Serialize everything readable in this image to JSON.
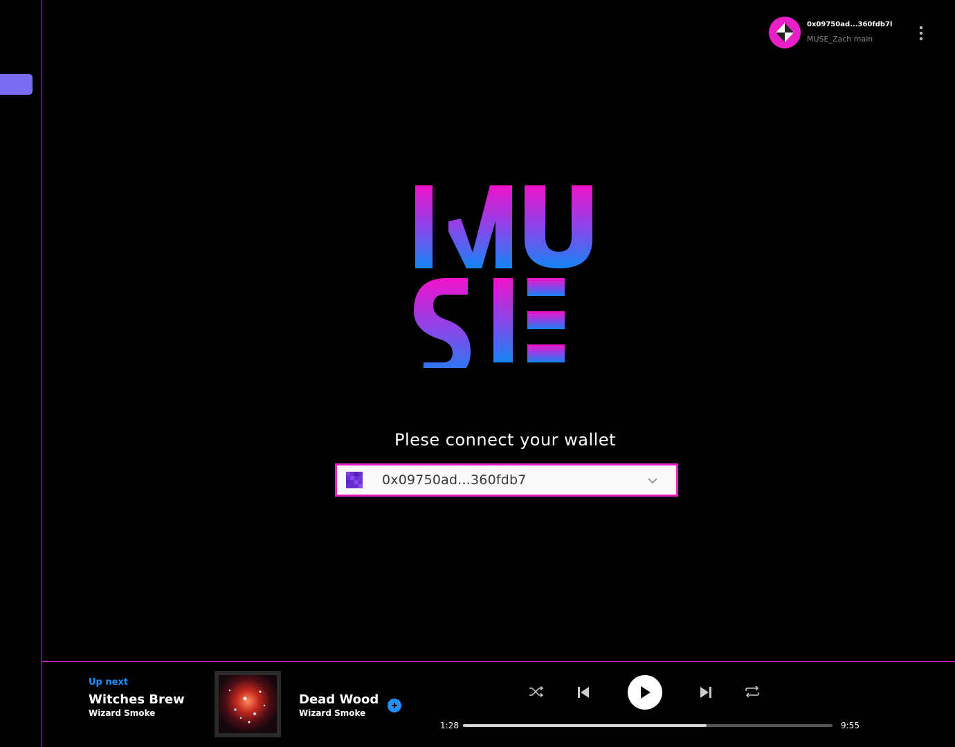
{
  "account": {
    "address": "0x09750ad...360fdb7l",
    "name": "MUSE_Zach main",
    "avatar_icon": "ethereum-diamond-icon"
  },
  "logo": {
    "text": "MUSE",
    "gradient_top": "#f012c9",
    "gradient_bottom": "#1685f5"
  },
  "connect": {
    "prompt": "Plese connect your wallet",
    "selected_wallet": "0x09750ad...360fdb7"
  },
  "player": {
    "up_next_label": "Up next",
    "up_next_title": "Witches Brew",
    "up_next_artist": "Wizard Smoke",
    "now_title": "Dead Wood",
    "now_artist": "Wizard Smoke",
    "time_elapsed": "1:28",
    "time_total": "9:55",
    "progress": 0.66
  },
  "colors": {
    "accent": "#e91fc8",
    "sidebar_active": "#7b6cf6",
    "link_blue": "#1e90ff"
  }
}
